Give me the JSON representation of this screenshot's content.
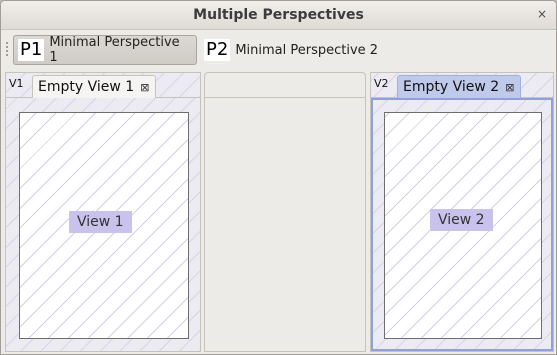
{
  "window": {
    "title": "Multiple Perspectives",
    "close_glyph": "×"
  },
  "perspectives": [
    {
      "badge": "P1",
      "label": "Minimal Perspective 1",
      "active": true
    },
    {
      "badge": "P2",
      "label": "Minimal Perspective 2",
      "active": false
    }
  ],
  "views": [
    {
      "badge": "V1",
      "tab_label": "Empty View 1",
      "close_glyph": "⊠",
      "content_label": "View 1",
      "selected": false
    },
    {
      "badge": "V2",
      "tab_label": "Empty View 2",
      "close_glyph": "⊠",
      "content_label": "View 2",
      "selected": true
    }
  ],
  "colors": {
    "hatch": "#d8d3e6",
    "selected_tab": "#bfc9ea",
    "view_label_bg": "#c9c2ec",
    "selected_border": "#8ea2d8"
  }
}
